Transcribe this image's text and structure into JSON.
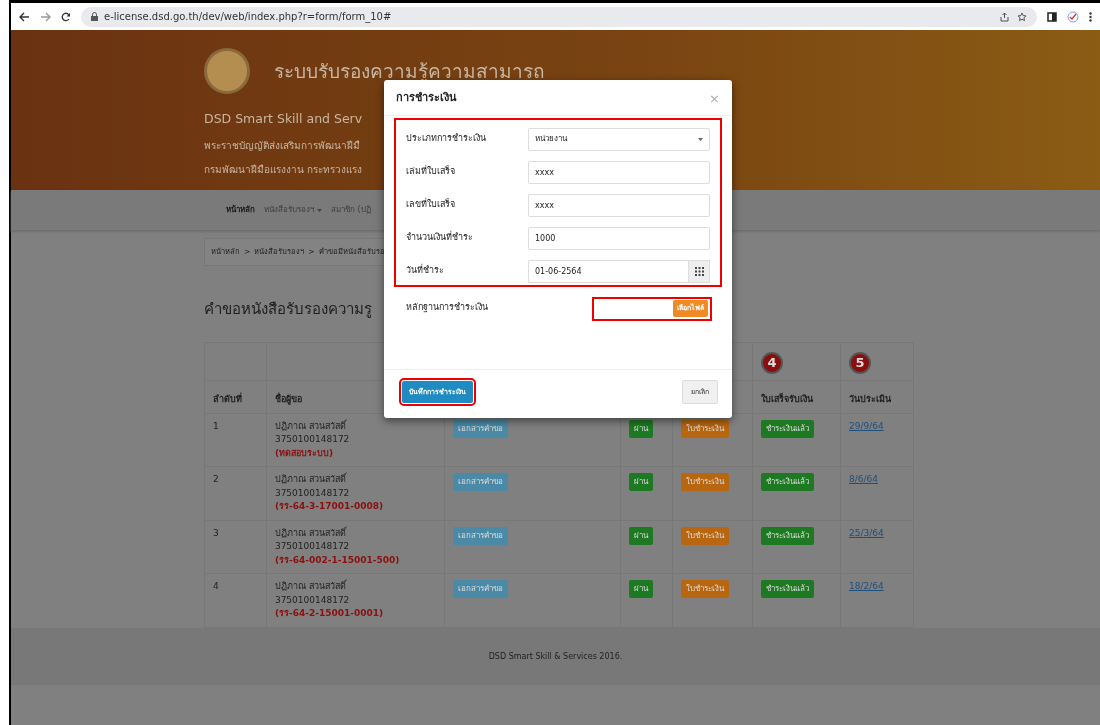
{
  "browser": {
    "url": "e-license.dsd.go.th/dev/web/index.php?r=form/form_10#"
  },
  "header": {
    "title": "ระบบรับรองความรู้ความสามารถ",
    "subtitle": "DSD Smart Skill and Serv",
    "lines": [
      "พระราชบัญญัติส่งเสริมการพัฒนาฝีมื",
      "กรมพัฒนาฝีมือแรงงาน กระทรวงแรง"
    ]
  },
  "nav": [
    {
      "label": "หน้าหลัก",
      "selected": true,
      "dropdown": false
    },
    {
      "label": "หนังสือรับรองฯ",
      "selected": false,
      "dropdown": true
    },
    {
      "label": "สมาชิก (ปฏิ",
      "selected": false,
      "dropdown": false
    }
  ],
  "breadcrumb": {
    "separator": ">",
    "items": [
      "หน้าหลัก",
      "หนังสือรับรองฯ",
      "คำขอมีหนังสือรับรอ"
    ]
  },
  "page_heading": "คำขอหนังสือรับรองความรู",
  "table": {
    "columns": [
      {
        "label": "ลำดับที่"
      },
      {
        "label": "ชื่อผู้ขอ"
      },
      {},
      {},
      {},
      {
        "label": "ใบเสร็จรับเงิน",
        "step": "4"
      },
      {
        "label": "วันประเมิน",
        "step": "5"
      }
    ],
    "rows": [
      {
        "number": "1",
        "name": "ปฏิภาณ สวนสวัสดิ์",
        "national_id": "3750100148172",
        "code": "(ทดสอบระบบ)",
        "document": "เอกสารคำขอ",
        "result": "ผ่าน",
        "payment": "ใบชำระเงิน",
        "receipt": "ชำระเงินแล้ว",
        "date": "29/9/64"
      },
      {
        "number": "2",
        "name": "ปฏิภาณ สวนสวัสดิ์",
        "national_id": "3750100148172",
        "code": "(รร-64-3-17001-0008)",
        "document": "เอกสารคำขอ",
        "result": "ผ่าน",
        "payment": "ใบชำระเงิน",
        "receipt": "ชำระเงินแล้ว",
        "date": "8/6/64"
      },
      {
        "number": "3",
        "name": "ปฏิภาณ สวนสวัสดิ์",
        "national_id": "3750100148172",
        "code": "(รร-64-002-1-15001-500)",
        "document": "เอกสารคำขอ",
        "result": "ผ่าน",
        "payment": "ใบชำระเงิน",
        "receipt": "ชำระเงินแล้ว",
        "date": "25/3/64"
      },
      {
        "number": "4",
        "name": "ปฏิภาณ สวนสวัสดิ์",
        "national_id": "3750100148172",
        "code": "(รร-64-2-15001-0001)",
        "document": "เอกสารคำขอ",
        "result": "ผ่าน",
        "payment": "ใบชำระเงิน",
        "receipt": "ชำระเงินแล้ว",
        "date": "18/2/64"
      }
    ]
  },
  "footer": "DSD Smart Skill & Services 2016.",
  "modal": {
    "title": "การชำระเงิน",
    "close": "×",
    "fields": [
      {
        "kind": "select",
        "label": "ประเภทการชำระเงิน",
        "value": "หน่วยงาน",
        "highlight": true
      },
      {
        "kind": "text",
        "label": "เล่มที่ใบเสร็จ",
        "value": "xxxx",
        "highlight": true
      },
      {
        "kind": "text",
        "label": "เลขที่ใบเสร็จ",
        "value": "xxxx",
        "highlight": true
      },
      {
        "kind": "text",
        "label": "จำนวนเงินที่ชำระ",
        "value": "1000",
        "highlight": true
      },
      {
        "kind": "date",
        "label": "วันที่ชำระ",
        "value": "01-06-2564",
        "highlight": true
      },
      {
        "kind": "file",
        "label": "หลักฐานการชำระเงิน",
        "button": "เลือกไฟล์",
        "highlight": true
      }
    ],
    "save": {
      "label": "บันทึกการชำระเงิน",
      "highlight": true
    },
    "cancel": {
      "label": "ยกเลิก"
    }
  }
}
